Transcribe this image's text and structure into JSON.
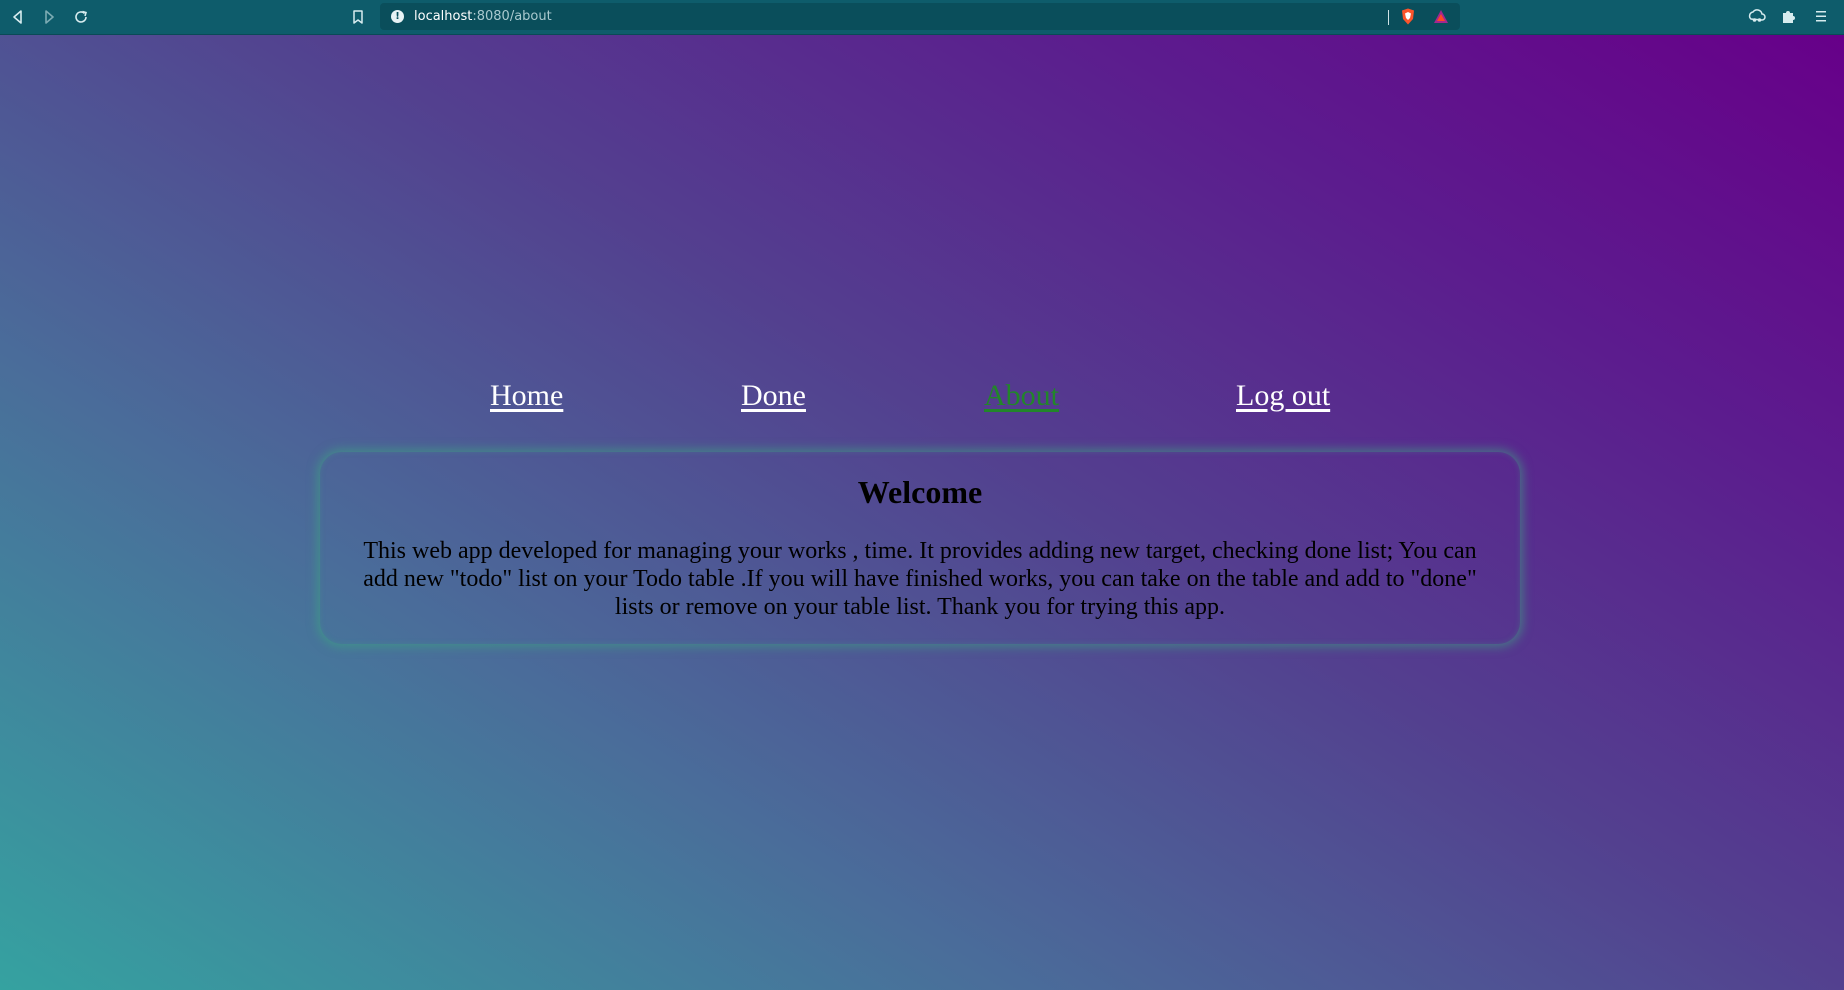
{
  "browser": {
    "url_host": "localhost",
    "url_path": ":8080/about",
    "icons": [
      "back-icon",
      "forward-icon",
      "reload-icon",
      "bookmark-icon",
      "site-info-icon",
      "brave-shields-icon",
      "brave-rewards-icon",
      "vpn-icon",
      "extensions-icon",
      "menu-icon"
    ]
  },
  "nav": {
    "home": "Home",
    "done": "Done",
    "about": "About",
    "logout": "Log out",
    "active": "About"
  },
  "card": {
    "title": "Welcome",
    "text": "This web app developed for managing your works , time. It provides adding new target, checking done list; You can add new \"todo\" list on your Todo table .If you will have finished works, you can take on the table and add to \"done\" lists or remove on your table list. Thank you for trying this app."
  },
  "colors": {
    "chrome": "#0e5c6b",
    "gradient_start": "#35a2a0",
    "gradient_end": "#670089",
    "nav_link": "#ffffff",
    "nav_active": "#22862a",
    "card_glow": "#3caa82"
  }
}
